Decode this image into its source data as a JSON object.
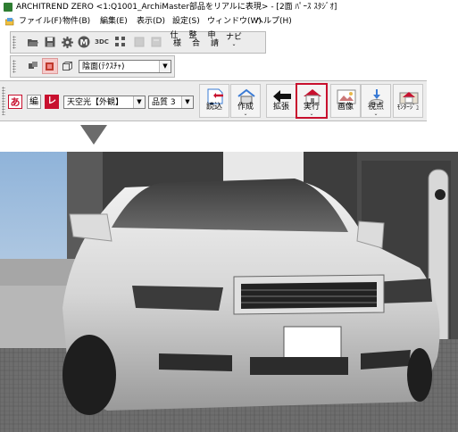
{
  "window": {
    "title": "ARCHITREND ZERO <1:Q1001_ArchiMaster部品をリアルに表現> - [2面 ﾊﾟｰｽ ｽﾀｼﾞｵ]"
  },
  "menu": {
    "items": [
      "ファイル(F)",
      "物件(B)",
      "編集(E)",
      "表示(D)",
      "設定(S)",
      "ウィンドウ(W)",
      "ヘルプ(H)"
    ]
  },
  "toolbar1": {
    "icons": [
      "open-icon",
      "save-icon",
      "settings-icon",
      "m-icon",
      "3dc-icon",
      "grid-icon",
      "disabled-icon-1",
      "disabled-icon-2"
    ],
    "text_3dc": "3DC",
    "text_m": "M",
    "shi_top": "仕",
    "shi_bot": "様",
    "sei_top": "整",
    "sei_bot": "合",
    "shin_top": "申",
    "shin_bot": "請",
    "navi_label": "ナビ"
  },
  "toolbar2": {
    "render_mode": "陰面(ﾃｸｽﾁｬ)"
  },
  "toolbar3": {
    "btn_a": "あ",
    "btn_hen": "編",
    "btn_re": "レ",
    "sky_value": "天空光【外観】",
    "quality_value": "品質 3",
    "buttons": [
      {
        "label": "読込",
        "dropdown": false
      },
      {
        "label": "作成",
        "dropdown": true
      },
      {
        "label": "拡張",
        "dropdown": false
      },
      {
        "label": "実行",
        "dropdown": true,
        "selected": true
      },
      {
        "label": "画像",
        "dropdown": false
      },
      {
        "label": "視点",
        "dropdown": true
      },
      {
        "label": "ﾓﾝﾀｰｼﾞｭ",
        "dropdown": false
      }
    ]
  },
  "colors": {
    "accent_red": "#c8102e",
    "toolbar_bg": "#ececec",
    "arrow_gray": "#6b6b6b"
  }
}
